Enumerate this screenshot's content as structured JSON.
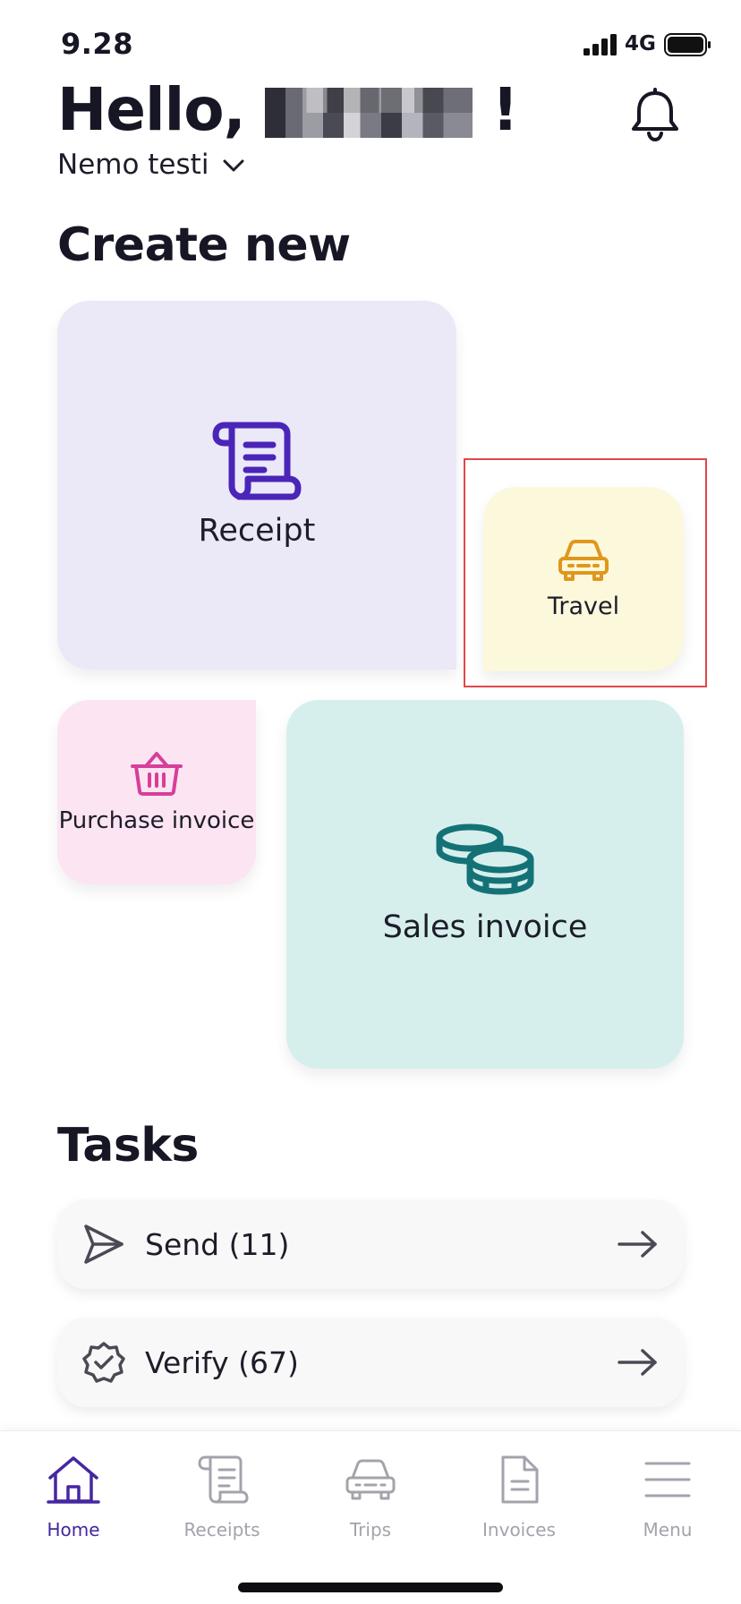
{
  "status_bar": {
    "time": "9.28",
    "network": "4G",
    "icons": [
      "signal-icon",
      "battery-icon"
    ]
  },
  "header": {
    "greeting": "Hello,",
    "exclamation": "!",
    "organization": "Nemo testi",
    "icons": [
      "bell-icon",
      "chevron-down-icon"
    ]
  },
  "create_new": {
    "title": "Create new",
    "tiles": [
      {
        "label": "Receipt",
        "icon": "receipt-scroll-icon",
        "color": "#ebe9f8",
        "icon_color": "#4a25b8"
      },
      {
        "label": "Travel",
        "icon": "car-icon",
        "color": "#fcf8dc",
        "icon_color": "#e0971c"
      },
      {
        "label": "Purchase invoice",
        "icon": "basket-icon",
        "color": "#fce4f2",
        "icon_color": "#d63f9a"
      },
      {
        "label": "Sales invoice",
        "icon": "coins-icon",
        "color": "#d6efed",
        "icon_color": "#147277"
      }
    ]
  },
  "tasks": {
    "title": "Tasks",
    "items": [
      {
        "label": "Send (11)",
        "icon": "send-icon"
      },
      {
        "label": "Verify (67)",
        "icon": "verify-badge-icon"
      }
    ]
  },
  "bottom_nav": {
    "items": [
      {
        "label": "Home",
        "icon": "home-icon",
        "active": true
      },
      {
        "label": "Receipts",
        "icon": "receipt-icon",
        "active": false
      },
      {
        "label": "Trips",
        "icon": "car-icon",
        "active": false
      },
      {
        "label": "Invoices",
        "icon": "document-icon",
        "active": false
      },
      {
        "label": "Menu",
        "icon": "hamburger-menu-icon",
        "active": false
      }
    ],
    "active_color": "#4527a0",
    "inactive_color": "#a3a3ac"
  }
}
